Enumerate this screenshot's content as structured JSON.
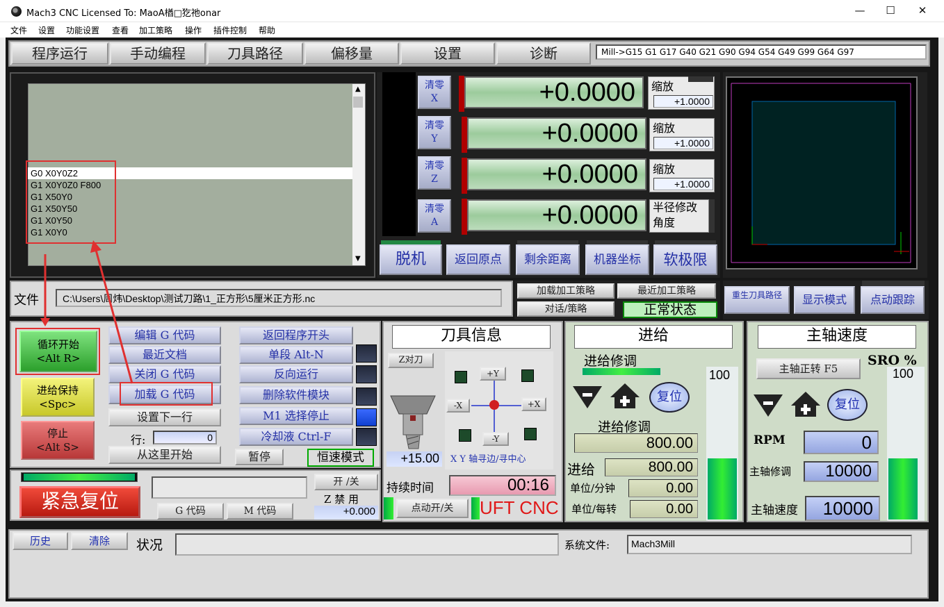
{
  "window": {
    "title": "Mach3 CNC  Licensed To: MaoA楢□犵祂onar",
    "minimize": "—",
    "maximize": "☐",
    "close": "✕"
  },
  "menu": [
    "文件",
    "设置",
    "功能设置",
    "查看",
    "加工策略",
    "操作",
    "插件控制",
    "帮助"
  ],
  "tabs": [
    "程序运行",
    "手动编程",
    "刀具路径",
    "偏移量",
    "设置",
    "诊断"
  ],
  "modal_line": "Mill->G15  G1 G17 G40 G21 G90 G94 G54 G49 G99 G64 G97",
  "gcode": {
    "lines": [
      "G0 X0Y0Z2",
      "G1 X0Y0Z0 F800",
      "G1 X50Y0",
      "G1 X50Y50",
      "G1 X0Y50",
      "G1 X0Y0"
    ],
    "selected_index": 0
  },
  "dro": {
    "zero_label": "清零",
    "axes": [
      {
        "axis": "X",
        "value": "+0.0000",
        "scale_label": "缩放",
        "scale": "+1.0000"
      },
      {
        "axis": "Y",
        "value": "+0.0000",
        "scale_label": "缩放",
        "scale": "+1.0000"
      },
      {
        "axis": "Z",
        "value": "+0.0000",
        "scale_label": "缩放",
        "scale": "+1.0000"
      },
      {
        "axis": "A",
        "value": "+0.0000",
        "radius_label": "半径修改",
        "angle_label": "角度"
      }
    ],
    "buttons": [
      "脱机",
      "返回原点",
      "剩余距离",
      "机器坐标",
      "软极限"
    ]
  },
  "file": {
    "label": "文件",
    "path": "C:\\Users\\周炜\\Desktop\\测试刀路\\1_正方形\\5厘米正方形.nc"
  },
  "strategy": {
    "load": "加载加工策略",
    "recent": "最近加工策略",
    "dialog": "对话/策略",
    "status": "正常状态"
  },
  "toolpath_btns": {
    "regen": "重生刀具路径",
    "display": "显示模式",
    "jog_follow": "点动跟踪"
  },
  "program": {
    "cycle_start": "循环开始\n<Alt R>",
    "feed_hold": "进给保持\n<Spc>",
    "stop": "停止\n<Alt S>",
    "edit": "编辑 G 代码",
    "recent": "最近文档",
    "close": "关闭 G 代码",
    "load": "加载 G 代码",
    "set_next": "设置下一行",
    "line_label": "行:",
    "line_value": "0",
    "run_from": "从这里开始",
    "rewind": "返回程序开头",
    "single": "单段 Alt-N",
    "reverse": "反向运行",
    "delete_mod": "删除软件模块",
    "m1": "M1 选择停止",
    "coolant": "冷却液 Ctrl-F",
    "pause": "暂停",
    "css": "恒速模式"
  },
  "emergency": {
    "reset": "紧急复位",
    "on_off": "开 /关",
    "zinhibit": "Z 禁 用",
    "z_value": "+0.000",
    "gcodes": "G 代码",
    "mcodes": "M 代码"
  },
  "tool": {
    "title": "刀具信息",
    "z_touch": "Z对刀",
    "z_value": "+15.00",
    "jog": {
      "py": "+Y",
      "ny": "-Y",
      "nx": "-X",
      "px": "+X"
    },
    "edge_finder": "X Y 轴寻边/寻中心",
    "elapsed_label": "持续时间",
    "elapsed": "00:16",
    "jog_onoff": "点动开/关",
    "brand": "UFT CNC"
  },
  "feed": {
    "title": "进给",
    "override_label": "进给修调",
    "override_pct": "100",
    "reset": "复位",
    "fro_label": "进给修调",
    "fro_value": "800.00",
    "feed_label": "进给",
    "feed_value": "800.00",
    "upm_label": "单位/分钟",
    "upm": "0.00",
    "upr_label": "单位/每转",
    "upr": "0.00",
    "bar_level": 0.45
  },
  "spindle": {
    "title": "主轴速度",
    "cw": "主轴正转 F5",
    "sro_label": "SRO %",
    "sro": "100",
    "reset": "复位",
    "rpm_label": "RPM",
    "rpm": "0",
    "so_label": "主轴修调",
    "so": "10000",
    "ss_label": "主轴速度",
    "ss": "10000",
    "bar_level": 0.45
  },
  "status": {
    "history": "历史",
    "clear": "清除",
    "status_label": "状况",
    "status_text": "",
    "profile_label": "系统文件:",
    "profile": "Mach3Mill"
  },
  "colors": {
    "annotation": "#e03030",
    "dro_green": "#9ccb9c",
    "bezel": "#171717"
  }
}
